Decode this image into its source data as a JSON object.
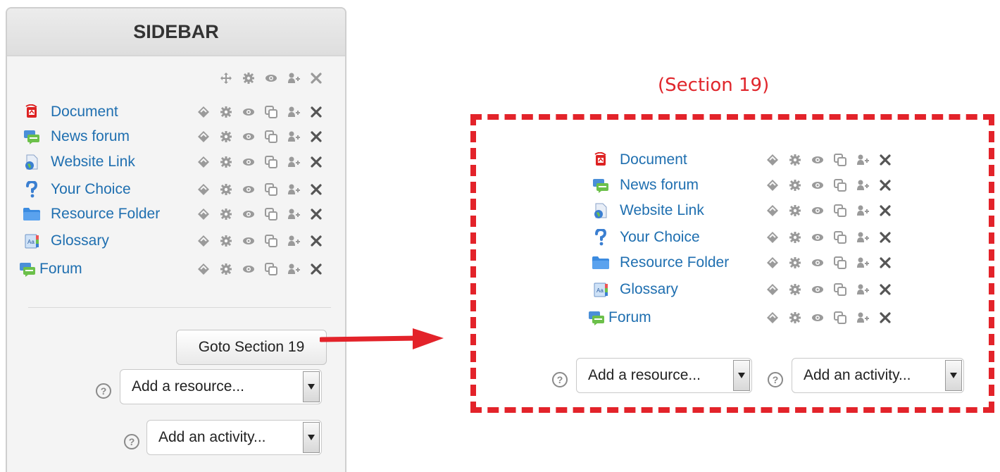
{
  "sidebar": {
    "title": "SIDEBAR",
    "header_controls": [
      "move-icon",
      "gear-icon",
      "eye-icon",
      "assign-role-icon",
      "close-icon"
    ],
    "activities": [
      {
        "label": "Document",
        "icon": "pdf-icon"
      },
      {
        "label": "News forum",
        "icon": "forum-icon"
      },
      {
        "label": "Website Link",
        "icon": "url-icon"
      },
      {
        "label": "Your Choice",
        "icon": "choice-icon"
      },
      {
        "label": "Resource Folder",
        "icon": "folder-icon"
      },
      {
        "label": "Glossary",
        "icon": "glossary-icon"
      },
      {
        "label": "Forum",
        "icon": "forum-icon"
      }
    ],
    "goto_button": "Goto Section 19",
    "add_resource": "Add a resource...",
    "add_activity": "Add an activity...",
    "help_glyph": "?"
  },
  "section": {
    "title": "(Section 19)",
    "activities": [
      {
        "label": "Document",
        "icon": "pdf-icon"
      },
      {
        "label": "News forum",
        "icon": "forum-icon"
      },
      {
        "label": "Website Link",
        "icon": "url-icon"
      },
      {
        "label": "Your Choice",
        "icon": "choice-icon"
      },
      {
        "label": "Resource Folder",
        "icon": "folder-icon"
      },
      {
        "label": "Glossary",
        "icon": "glossary-icon"
      },
      {
        "label": "Forum",
        "icon": "forum-icon"
      }
    ],
    "add_resource": "Add a resource...",
    "add_activity": "Add an activity...",
    "help_glyph": "?"
  },
  "colors": {
    "link": "#1f6fb0",
    "accent_red": "#e3232a",
    "icon_gray": "#555555"
  }
}
